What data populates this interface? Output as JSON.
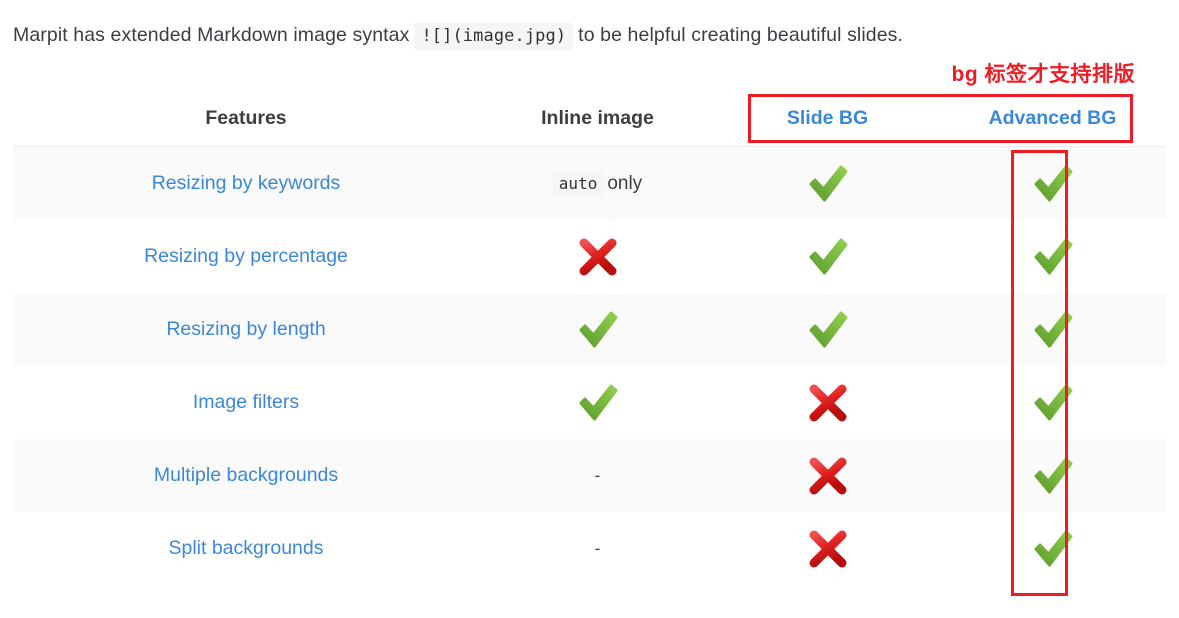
{
  "intro": {
    "before": "Marpit has extended Markdown image syntax",
    "code": "![](image.jpg)",
    "after": "to be helpful creating beautiful slides."
  },
  "annotation": {
    "text": "bg 标签才支持排版",
    "color": "#ee1c25"
  },
  "table": {
    "headers": [
      {
        "label": "Features",
        "is_link": false
      },
      {
        "label": "Inline image",
        "is_link": false
      },
      {
        "label": "Slide BG",
        "is_link": true
      },
      {
        "label": "Advanced BG",
        "is_link": true
      }
    ],
    "rows": [
      {
        "feature": "Resizing by keywords",
        "inline_image": {
          "type": "code-text",
          "code": "auto",
          "text": "only"
        },
        "slide_bg": {
          "type": "check"
        },
        "advanced_bg": {
          "type": "check"
        }
      },
      {
        "feature": "Resizing by percentage",
        "inline_image": {
          "type": "cross"
        },
        "slide_bg": {
          "type": "check"
        },
        "advanced_bg": {
          "type": "check"
        }
      },
      {
        "feature": "Resizing by length",
        "inline_image": {
          "type": "check"
        },
        "slide_bg": {
          "type": "check"
        },
        "advanced_bg": {
          "type": "check"
        }
      },
      {
        "feature": "Image filters",
        "inline_image": {
          "type": "check"
        },
        "slide_bg": {
          "type": "cross"
        },
        "advanced_bg": {
          "type": "check"
        }
      },
      {
        "feature": "Multiple backgrounds",
        "inline_image": {
          "type": "dash",
          "text": "-"
        },
        "slide_bg": {
          "type": "cross"
        },
        "advanced_bg": {
          "type": "check"
        }
      },
      {
        "feature": "Split backgrounds",
        "inline_image": {
          "type": "dash",
          "text": "-"
        },
        "slide_bg": {
          "type": "cross"
        },
        "advanced_bg": {
          "type": "check"
        }
      }
    ]
  },
  "highlights": {
    "header_box": {
      "label": "background-columns-header-highlight"
    },
    "column_box": {
      "label": "advanced-bg-column-highlight"
    }
  },
  "colors": {
    "link": "#3b87d8",
    "check": "#78b544",
    "cross": "#d81f1f",
    "highlight": "#ee1c25",
    "stripe": "#fafafa",
    "text": "#3a3f44"
  }
}
